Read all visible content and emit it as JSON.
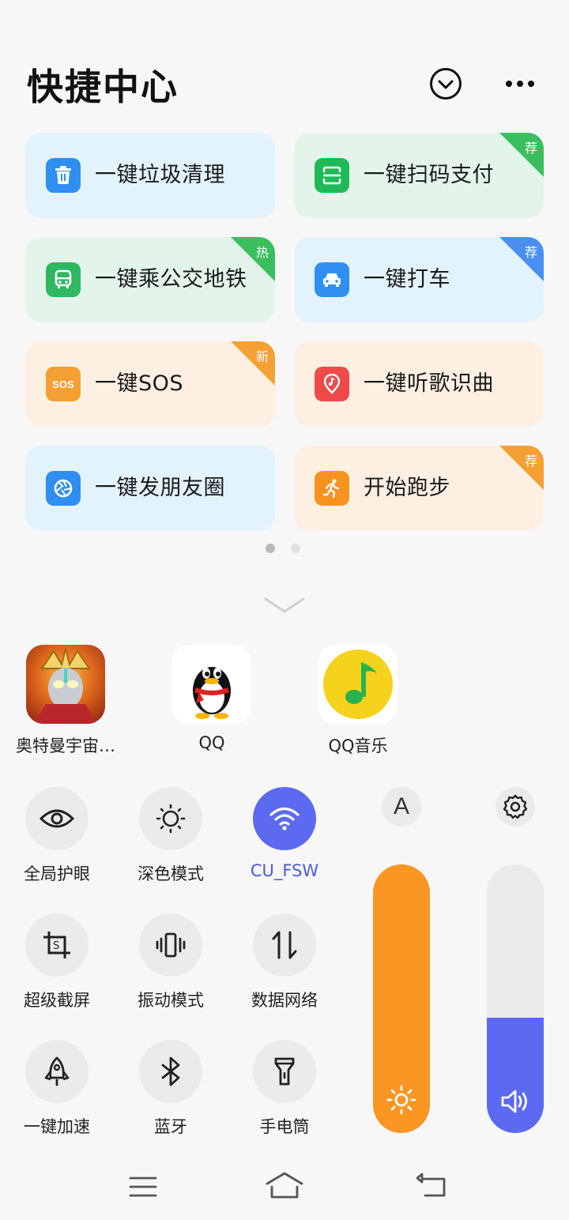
{
  "header": {
    "title": "快捷中心"
  },
  "shortcuts": [
    {
      "label": "一键垃圾清理",
      "icon": "trash-icon",
      "color": "#2f8ff0",
      "bg": "blue",
      "badge": ""
    },
    {
      "label": "一键扫码支付",
      "icon": "scan-icon",
      "color": "#1fba57",
      "bg": "green",
      "badge": "荐",
      "badge_color": "#3bbf5e"
    },
    {
      "label": "一键乘公交地铁",
      "icon": "bus-icon",
      "color": "#2fb860",
      "bg": "green",
      "badge": "热",
      "badge_color": "#3bbf5e"
    },
    {
      "label": "一键打车",
      "icon": "car-icon",
      "color": "#2f8ff0",
      "bg": "blue",
      "badge": "荐",
      "badge_color": "#4a8ff0"
    },
    {
      "label": "一键SOS",
      "icon": "sos-icon",
      "color": "#f5a032",
      "bg": "orange",
      "badge": "新",
      "badge_color": "#f5a032"
    },
    {
      "label": "一键听歌识曲",
      "icon": "music-pin-icon",
      "color": "#ef4a4a",
      "bg": "orange",
      "badge": ""
    },
    {
      "label": "一键发朋友圈",
      "icon": "camera-shutter-icon",
      "color": "#2f8ff0",
      "bg": "blue",
      "badge": ""
    },
    {
      "label": "开始跑步",
      "icon": "running-icon",
      "color": "#f5931e",
      "bg": "orange",
      "badge": "荐",
      "badge_color": "#f5a032"
    }
  ],
  "apps": [
    {
      "name": "奥特曼宇宙…",
      "icon": "ultraman-game-icon"
    },
    {
      "name": "QQ",
      "icon": "qq-penguin-icon"
    },
    {
      "name": "QQ音乐",
      "icon": "qq-music-icon"
    }
  ],
  "toggles": [
    {
      "label": "全局护眼",
      "icon": "eye-icon",
      "active": false
    },
    {
      "label": "深色模式",
      "icon": "dark-mode-icon",
      "active": false
    },
    {
      "label": "CU_FSW",
      "icon": "wifi-icon",
      "active": true
    },
    {
      "label": "超级截屏",
      "icon": "screenshot-icon",
      "active": false
    },
    {
      "label": "振动模式",
      "icon": "vibrate-icon",
      "active": false
    },
    {
      "label": "数据网络",
      "icon": "data-network-icon",
      "active": false
    },
    {
      "label": "一键加速",
      "icon": "rocket-icon",
      "active": false
    },
    {
      "label": "蓝牙",
      "icon": "bluetooth-icon",
      "active": false
    },
    {
      "label": "手电筒",
      "icon": "flashlight-icon",
      "active": false
    }
  ],
  "auto_brightness_label": "A",
  "brightness": {
    "level": 1.0,
    "color": "#fa9624"
  },
  "volume": {
    "level": 0.43,
    "color": "#5b6af0"
  },
  "pager": {
    "pages": 2,
    "current": 1
  },
  "colors": {
    "accent": "#5b6af0",
    "wifi_label": "#4a5ae0"
  }
}
